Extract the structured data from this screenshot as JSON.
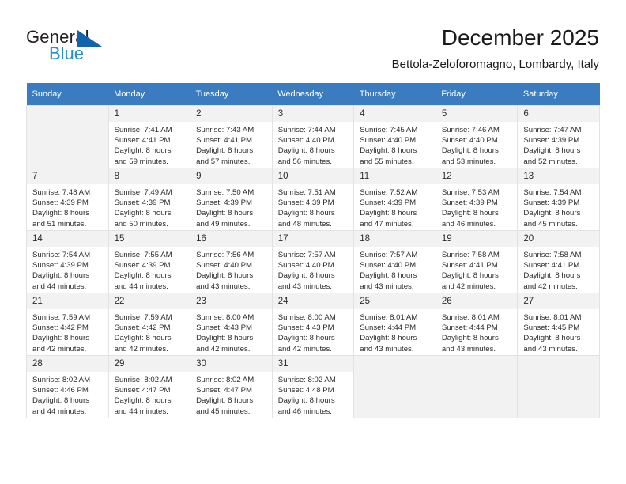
{
  "brand": {
    "name_part1": "General",
    "name_part2": "Blue",
    "primary_color": "#1263ad",
    "secondary_color": "#1f8fd6"
  },
  "header": {
    "title": "December 2025",
    "subtitle": "Bettola-Zeloforomagno, Lombardy, Italy"
  },
  "calendar": {
    "header_color": "#3b7cc0",
    "weekdays": [
      "Sunday",
      "Monday",
      "Tuesday",
      "Wednesday",
      "Thursday",
      "Friday",
      "Saturday"
    ],
    "labels": {
      "sunrise": "Sunrise:",
      "sunset": "Sunset:",
      "daylight": "Daylight:"
    },
    "weeks": [
      [
        {
          "day": "",
          "empty": true
        },
        {
          "day": "1",
          "sunrise": "Sunrise: 7:41 AM",
          "sunset": "Sunset: 4:41 PM",
          "daylight_line1": "Daylight: 8 hours",
          "daylight_line2": "and 59 minutes."
        },
        {
          "day": "2",
          "sunrise": "Sunrise: 7:43 AM",
          "sunset": "Sunset: 4:41 PM",
          "daylight_line1": "Daylight: 8 hours",
          "daylight_line2": "and 57 minutes."
        },
        {
          "day": "3",
          "sunrise": "Sunrise: 7:44 AM",
          "sunset": "Sunset: 4:40 PM",
          "daylight_line1": "Daylight: 8 hours",
          "daylight_line2": "and 56 minutes."
        },
        {
          "day": "4",
          "sunrise": "Sunrise: 7:45 AM",
          "sunset": "Sunset: 4:40 PM",
          "daylight_line1": "Daylight: 8 hours",
          "daylight_line2": "and 55 minutes."
        },
        {
          "day": "5",
          "sunrise": "Sunrise: 7:46 AM",
          "sunset": "Sunset: 4:40 PM",
          "daylight_line1": "Daylight: 8 hours",
          "daylight_line2": "and 53 minutes."
        },
        {
          "day": "6",
          "sunrise": "Sunrise: 7:47 AM",
          "sunset": "Sunset: 4:39 PM",
          "daylight_line1": "Daylight: 8 hours",
          "daylight_line2": "and 52 minutes."
        }
      ],
      [
        {
          "day": "7",
          "sunrise": "Sunrise: 7:48 AM",
          "sunset": "Sunset: 4:39 PM",
          "daylight_line1": "Daylight: 8 hours",
          "daylight_line2": "and 51 minutes."
        },
        {
          "day": "8",
          "sunrise": "Sunrise: 7:49 AM",
          "sunset": "Sunset: 4:39 PM",
          "daylight_line1": "Daylight: 8 hours",
          "daylight_line2": "and 50 minutes."
        },
        {
          "day": "9",
          "sunrise": "Sunrise: 7:50 AM",
          "sunset": "Sunset: 4:39 PM",
          "daylight_line1": "Daylight: 8 hours",
          "daylight_line2": "and 49 minutes."
        },
        {
          "day": "10",
          "sunrise": "Sunrise: 7:51 AM",
          "sunset": "Sunset: 4:39 PM",
          "daylight_line1": "Daylight: 8 hours",
          "daylight_line2": "and 48 minutes."
        },
        {
          "day": "11",
          "sunrise": "Sunrise: 7:52 AM",
          "sunset": "Sunset: 4:39 PM",
          "daylight_line1": "Daylight: 8 hours",
          "daylight_line2": "and 47 minutes."
        },
        {
          "day": "12",
          "sunrise": "Sunrise: 7:53 AM",
          "sunset": "Sunset: 4:39 PM",
          "daylight_line1": "Daylight: 8 hours",
          "daylight_line2": "and 46 minutes."
        },
        {
          "day": "13",
          "sunrise": "Sunrise: 7:54 AM",
          "sunset": "Sunset: 4:39 PM",
          "daylight_line1": "Daylight: 8 hours",
          "daylight_line2": "and 45 minutes."
        }
      ],
      [
        {
          "day": "14",
          "sunrise": "Sunrise: 7:54 AM",
          "sunset": "Sunset: 4:39 PM",
          "daylight_line1": "Daylight: 8 hours",
          "daylight_line2": "and 44 minutes."
        },
        {
          "day": "15",
          "sunrise": "Sunrise: 7:55 AM",
          "sunset": "Sunset: 4:39 PM",
          "daylight_line1": "Daylight: 8 hours",
          "daylight_line2": "and 44 minutes."
        },
        {
          "day": "16",
          "sunrise": "Sunrise: 7:56 AM",
          "sunset": "Sunset: 4:40 PM",
          "daylight_line1": "Daylight: 8 hours",
          "daylight_line2": "and 43 minutes."
        },
        {
          "day": "17",
          "sunrise": "Sunrise: 7:57 AM",
          "sunset": "Sunset: 4:40 PM",
          "daylight_line1": "Daylight: 8 hours",
          "daylight_line2": "and 43 minutes."
        },
        {
          "day": "18",
          "sunrise": "Sunrise: 7:57 AM",
          "sunset": "Sunset: 4:40 PM",
          "daylight_line1": "Daylight: 8 hours",
          "daylight_line2": "and 43 minutes."
        },
        {
          "day": "19",
          "sunrise": "Sunrise: 7:58 AM",
          "sunset": "Sunset: 4:41 PM",
          "daylight_line1": "Daylight: 8 hours",
          "daylight_line2": "and 42 minutes."
        },
        {
          "day": "20",
          "sunrise": "Sunrise: 7:58 AM",
          "sunset": "Sunset: 4:41 PM",
          "daylight_line1": "Daylight: 8 hours",
          "daylight_line2": "and 42 minutes."
        }
      ],
      [
        {
          "day": "21",
          "sunrise": "Sunrise: 7:59 AM",
          "sunset": "Sunset: 4:42 PM",
          "daylight_line1": "Daylight: 8 hours",
          "daylight_line2": "and 42 minutes."
        },
        {
          "day": "22",
          "sunrise": "Sunrise: 7:59 AM",
          "sunset": "Sunset: 4:42 PM",
          "daylight_line1": "Daylight: 8 hours",
          "daylight_line2": "and 42 minutes."
        },
        {
          "day": "23",
          "sunrise": "Sunrise: 8:00 AM",
          "sunset": "Sunset: 4:43 PM",
          "daylight_line1": "Daylight: 8 hours",
          "daylight_line2": "and 42 minutes."
        },
        {
          "day": "24",
          "sunrise": "Sunrise: 8:00 AM",
          "sunset": "Sunset: 4:43 PM",
          "daylight_line1": "Daylight: 8 hours",
          "daylight_line2": "and 42 minutes."
        },
        {
          "day": "25",
          "sunrise": "Sunrise: 8:01 AM",
          "sunset": "Sunset: 4:44 PM",
          "daylight_line1": "Daylight: 8 hours",
          "daylight_line2": "and 43 minutes."
        },
        {
          "day": "26",
          "sunrise": "Sunrise: 8:01 AM",
          "sunset": "Sunset: 4:44 PM",
          "daylight_line1": "Daylight: 8 hours",
          "daylight_line2": "and 43 minutes."
        },
        {
          "day": "27",
          "sunrise": "Sunrise: 8:01 AM",
          "sunset": "Sunset: 4:45 PM",
          "daylight_line1": "Daylight: 8 hours",
          "daylight_line2": "and 43 minutes."
        }
      ],
      [
        {
          "day": "28",
          "sunrise": "Sunrise: 8:02 AM",
          "sunset": "Sunset: 4:46 PM",
          "daylight_line1": "Daylight: 8 hours",
          "daylight_line2": "and 44 minutes."
        },
        {
          "day": "29",
          "sunrise": "Sunrise: 8:02 AM",
          "sunset": "Sunset: 4:47 PM",
          "daylight_line1": "Daylight: 8 hours",
          "daylight_line2": "and 44 minutes."
        },
        {
          "day": "30",
          "sunrise": "Sunrise: 8:02 AM",
          "sunset": "Sunset: 4:47 PM",
          "daylight_line1": "Daylight: 8 hours",
          "daylight_line2": "and 45 minutes."
        },
        {
          "day": "31",
          "sunrise": "Sunrise: 8:02 AM",
          "sunset": "Sunset: 4:48 PM",
          "daylight_line1": "Daylight: 8 hours",
          "daylight_line2": "and 46 minutes."
        },
        {
          "day": "",
          "empty": true
        },
        {
          "day": "",
          "empty": true
        },
        {
          "day": "",
          "empty": true
        }
      ]
    ]
  }
}
